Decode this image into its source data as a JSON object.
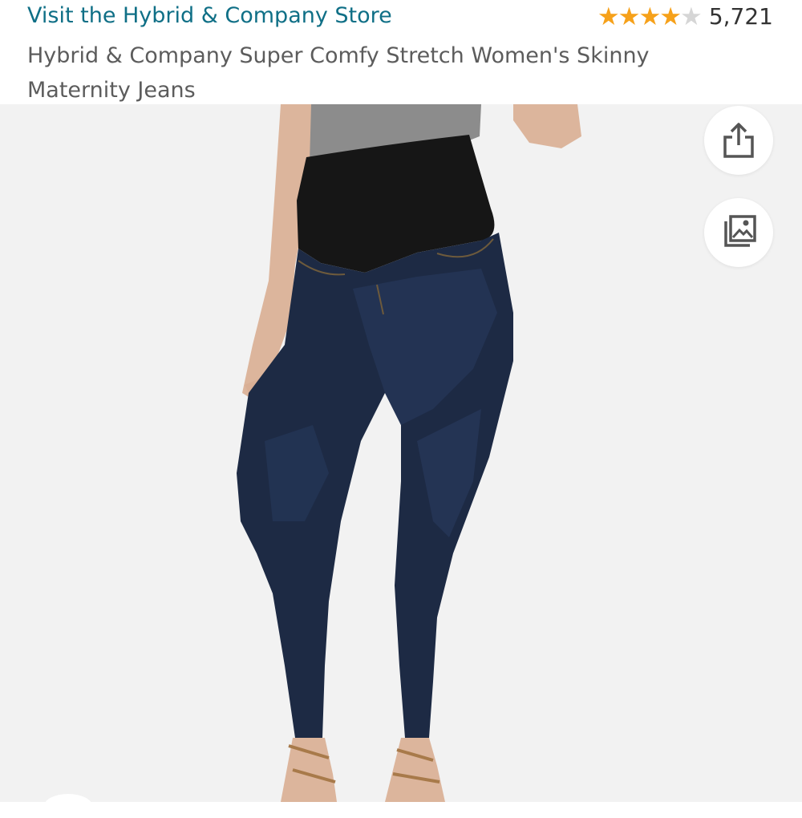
{
  "header": {
    "store_link": "Visit the Hybrid & Company Store",
    "rating": {
      "stars": 4,
      "max_stars": 5,
      "count": "5,721"
    },
    "product_title": "Hybrid & Company Super Comfy Stretch Women's Skinny Maternity Jeans"
  },
  "image": {
    "icons": {
      "share": "share-icon",
      "gallery": "view-in-room-icon"
    }
  },
  "colors": {
    "link": "#0f6f86",
    "star": "#f6a11a",
    "title": "#5c5c5c",
    "image_background": "#f2f2f2"
  }
}
